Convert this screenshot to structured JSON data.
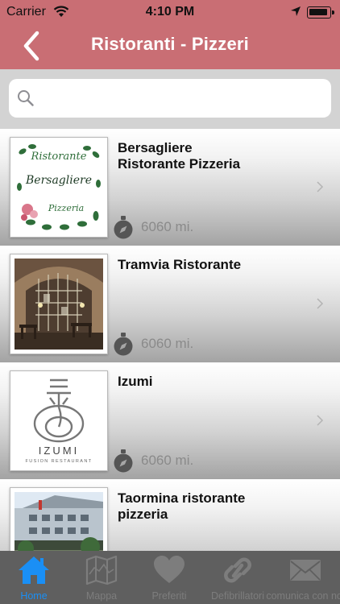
{
  "status_bar": {
    "carrier": "Carrier",
    "time": "4:10 PM"
  },
  "nav": {
    "title": "Ristoranti - Pizzeri"
  },
  "search": {
    "placeholder": "",
    "value": ""
  },
  "restaurants": [
    {
      "name": "Bersagliere\nRistorante Pizzeria",
      "distance": "6060 mi.",
      "logo_text": [
        "Ristorante",
        "Bersagliere",
        "Pizzeria"
      ]
    },
    {
      "name": "Tramvia Ristorante",
      "distance": "6060 mi."
    },
    {
      "name": "Izumi",
      "distance": "6060 mi.",
      "logo_text": [
        "IZUMI",
        "FUSION RESTAURANT"
      ]
    },
    {
      "name": "Taormina ristorante\npizzeria",
      "distance": ""
    }
  ],
  "tabs": [
    {
      "label": "Home",
      "icon": "home-icon",
      "active": true
    },
    {
      "label": "Mappa",
      "icon": "map-icon",
      "active": false
    },
    {
      "label": "Preferiti",
      "icon": "heart-icon",
      "active": false
    },
    {
      "label": "Defibrillatori",
      "icon": "link-icon",
      "active": false
    },
    {
      "label": "comunica con noi",
      "icon": "mail-icon",
      "active": false
    }
  ],
  "colors": {
    "header": "#c96e74",
    "tab_active": "#1a8ff5",
    "tab_inactive": "#7d7d7d",
    "tab_bar": "#5f5f5f"
  }
}
